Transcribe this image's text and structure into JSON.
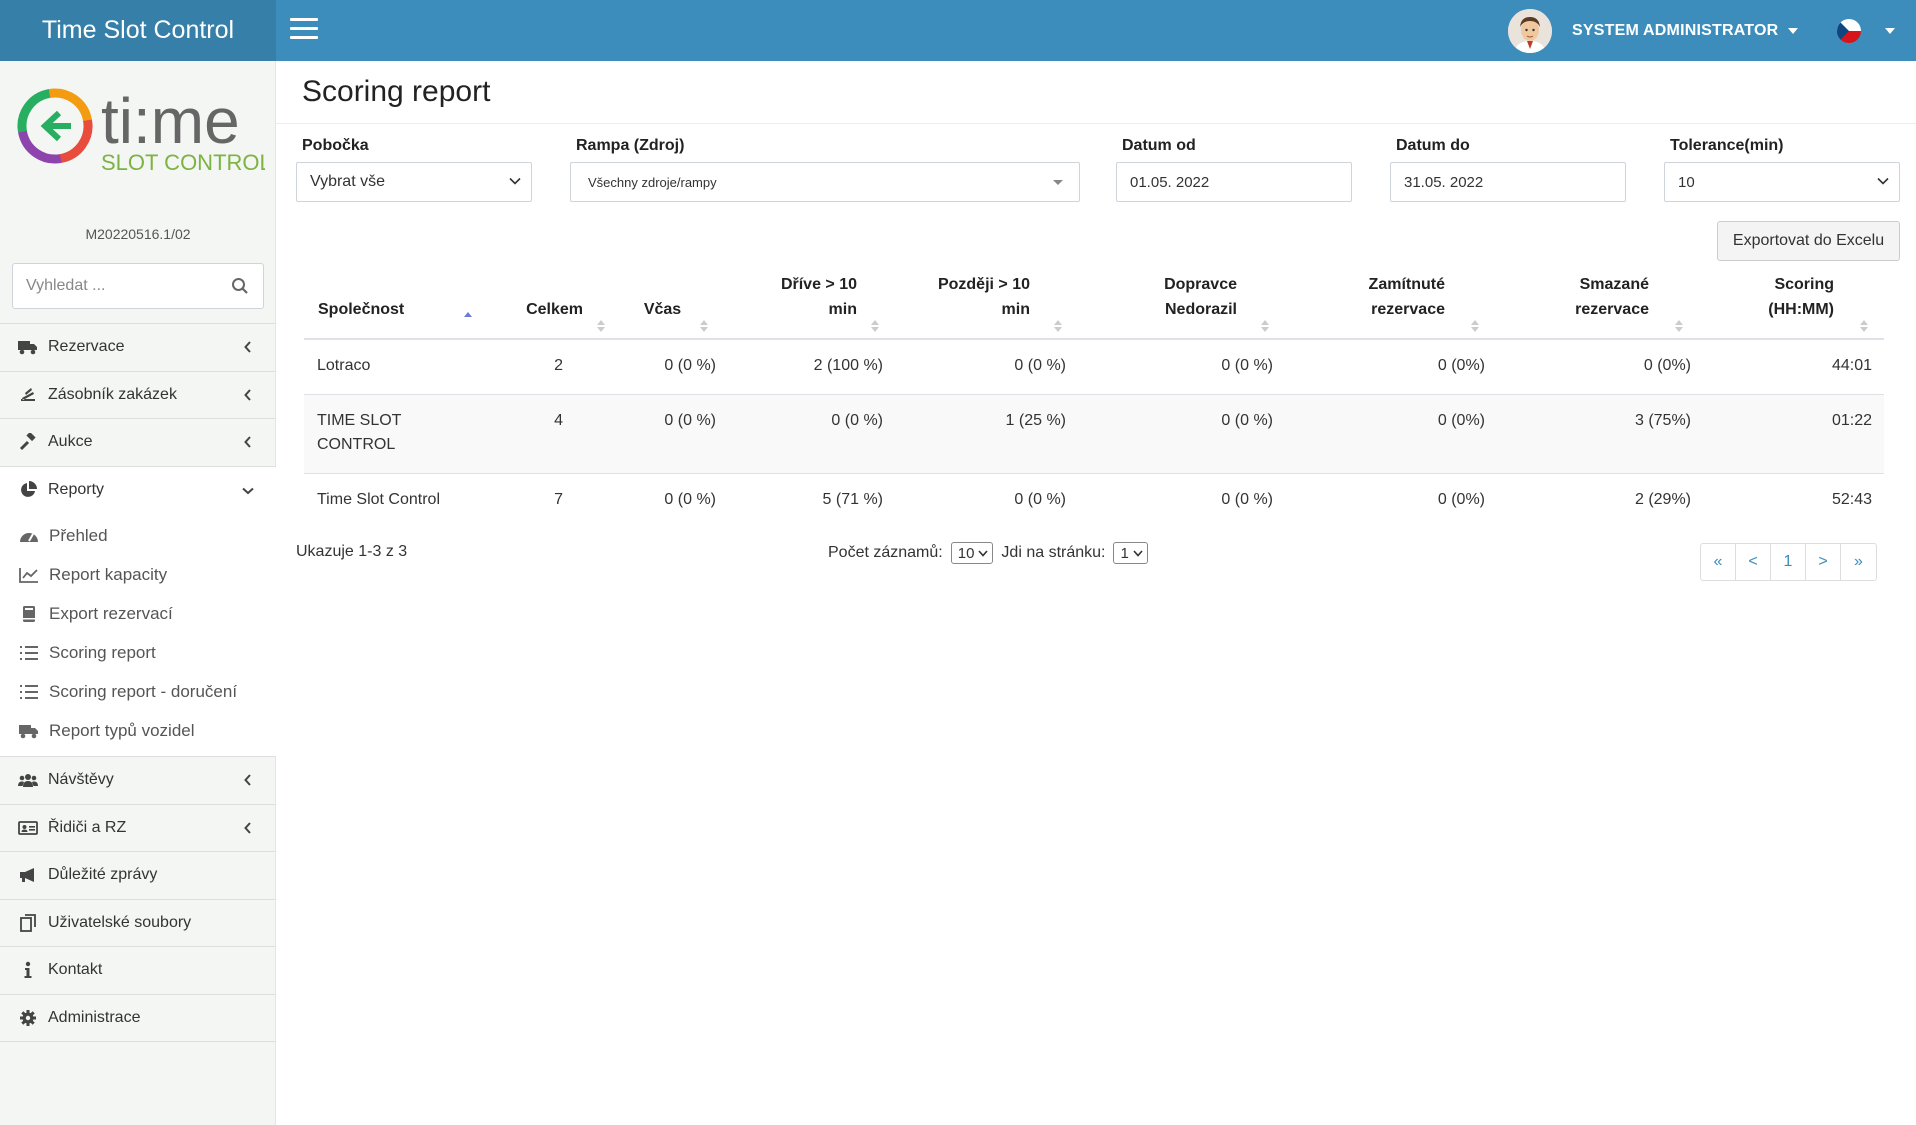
{
  "app": {
    "brand": "Time Slot Control",
    "user_name": "SYSTEM ADMINISTRATOR",
    "version": "M20220516.1/02",
    "logo_text_main": "ti:me",
    "logo_text_sub": "SLOT CONTROL"
  },
  "colors": {
    "topbar": "#3c8dbc",
    "brand_bg": "#367fa9",
    "link": "#3c8dbc"
  },
  "sidebar": {
    "search_placeholder": "Vyhledat ...",
    "items": [
      {
        "label": "Rezervace",
        "icon": "truck-icon"
      },
      {
        "label": "Zásobník zakázek",
        "icon": "stack-icon"
      },
      {
        "label": "Aukce",
        "icon": "gavel-icon"
      },
      {
        "label": "Reporty",
        "icon": "pie-chart-icon",
        "open": true
      },
      {
        "label": "Návštěvy",
        "icon": "users-icon"
      },
      {
        "label": "Řidiči a RZ",
        "icon": "id-card-icon"
      },
      {
        "label": "Důležité zprávy",
        "icon": "megaphone-icon"
      },
      {
        "label": "Uživatelské soubory",
        "icon": "files-icon"
      },
      {
        "label": "Kontakt",
        "icon": "info-icon"
      },
      {
        "label": "Administrace",
        "icon": "gear-icon"
      }
    ],
    "report_sub": [
      {
        "label": "Přehled",
        "icon": "dashboard-icon"
      },
      {
        "label": "Report kapacity",
        "icon": "line-chart-icon"
      },
      {
        "label": "Export rezervací",
        "icon": "book-icon"
      },
      {
        "label": "Scoring report",
        "icon": "list-icon"
      },
      {
        "label": "Scoring report - doručení",
        "icon": "list-icon"
      },
      {
        "label": "Report typů vozidel",
        "icon": "truck-icon"
      }
    ]
  },
  "page": {
    "title": "Scoring report",
    "export_label": "Exportovat do Excelu"
  },
  "filters": {
    "branch_label": "Pobočka",
    "branch_value": "Vybrat vše",
    "ramp_label": "Rampa (Zdroj)",
    "ramp_value": "Všechny zdroje/rampy",
    "date_from_label": "Datum od",
    "date_from_value": "01.05. 2022",
    "date_to_label": "Datum do",
    "date_to_value": "31.05. 2022",
    "tolerance_label": "Tolerance(min)",
    "tolerance_value": "10"
  },
  "table": {
    "headers": [
      [
        "Společnost"
      ],
      [
        "Celkem"
      ],
      [
        "Včas"
      ],
      [
        "Dříve > 10",
        "min"
      ],
      [
        "Později > 10",
        "min"
      ],
      [
        "Dopravce",
        "Nedorazil"
      ],
      [
        "Zamítnuté",
        "rezervace"
      ],
      [
        "Smazané",
        "rezervace"
      ],
      [
        "Scoring",
        "(HH:MM)"
      ]
    ],
    "rows": [
      {
        "company": "Lotraco",
        "total": "2",
        "ontime": "0 (0 %)",
        "early": "2 (100 %)",
        "late": "0 (0 %)",
        "noshow": "0 (0 %)",
        "rejected": "0 (0%)",
        "deleted": "0 (0%)",
        "scoring": "44:01"
      },
      {
        "company": "TIME SLOT CONTROL",
        "total": "4",
        "ontime": "0 (0 %)",
        "early": "0 (0 %)",
        "late": "1 (25 %)",
        "noshow": "0 (0 %)",
        "rejected": "0 (0%)",
        "deleted": "3 (75%)",
        "scoring": "01:22"
      },
      {
        "company": "Time Slot Control",
        "total": "7",
        "ontime": "0 (0 %)",
        "early": "5 (71 %)",
        "late": "0 (0 %)",
        "noshow": "0 (0 %)",
        "rejected": "0 (0%)",
        "deleted": "2 (29%)",
        "scoring": "52:43"
      }
    ]
  },
  "footer": {
    "info": "Ukazuje 1-3 z 3",
    "records_label": "Počet záznamů:",
    "records_value": "10",
    "goto_label": "Jdi na stránku:",
    "goto_value": "1",
    "pager": [
      "«",
      "<",
      "1",
      ">",
      "»"
    ]
  }
}
